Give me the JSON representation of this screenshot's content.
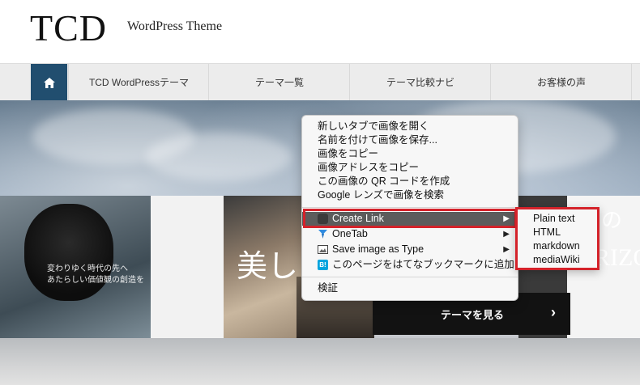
{
  "header": {
    "logo": "TCD",
    "tagline": "WordPress Theme"
  },
  "nav": {
    "home_icon": "home-icon",
    "items": [
      {
        "label": "TCD WordPressテーマ"
      },
      {
        "label": "テーマ一覧"
      },
      {
        "label": "テーマ比較ナビ"
      },
      {
        "label": "お客様の声"
      }
    ]
  },
  "hero": {
    "headline_left": "美しい",
    "headline_right_char": "の",
    "headline_right_latin": "RIZO",
    "slide_caption_1": "変わりゆく時代の先へ",
    "slide_caption_2": "あたらしい価値観の創造を",
    "button_label": "テーマを見る",
    "button_arrow": "›"
  },
  "context_menu": {
    "items_group1": [
      {
        "label": "新しいタブで画像を開く"
      },
      {
        "label": "名前を付けて画像を保存..."
      },
      {
        "label": "画像をコピー"
      },
      {
        "label": "画像アドレスをコピー"
      },
      {
        "label": "この画像の QR コードを作成"
      },
      {
        "label": "Google レンズで画像を検索"
      }
    ],
    "items_group2": [
      {
        "label": "Create Link",
        "icon": "create-link-icon",
        "has_submenu": true
      },
      {
        "label": "OneTab",
        "icon": "onetab-icon",
        "has_submenu": true
      },
      {
        "label": "Save image as Type",
        "icon": "image-icon",
        "has_submenu": true
      },
      {
        "label": "このページをはてなブックマークに追加",
        "icon": "hatena-bookmark-icon",
        "has_submenu": false
      }
    ],
    "items_group3": [
      {
        "label": "検証"
      }
    ],
    "submenu_arrow": "▶",
    "highlight_color": "#d4222a"
  },
  "submenu": {
    "items": [
      {
        "label": "Plain text"
      },
      {
        "label": "HTML"
      },
      {
        "label": "markdown"
      },
      {
        "label": "mediaWiki"
      }
    ]
  },
  "colors": {
    "nav_home_bg": "#214e6f",
    "hero_button_bg": "#121212",
    "menu_highlight_bg": "#5c5c5c"
  }
}
